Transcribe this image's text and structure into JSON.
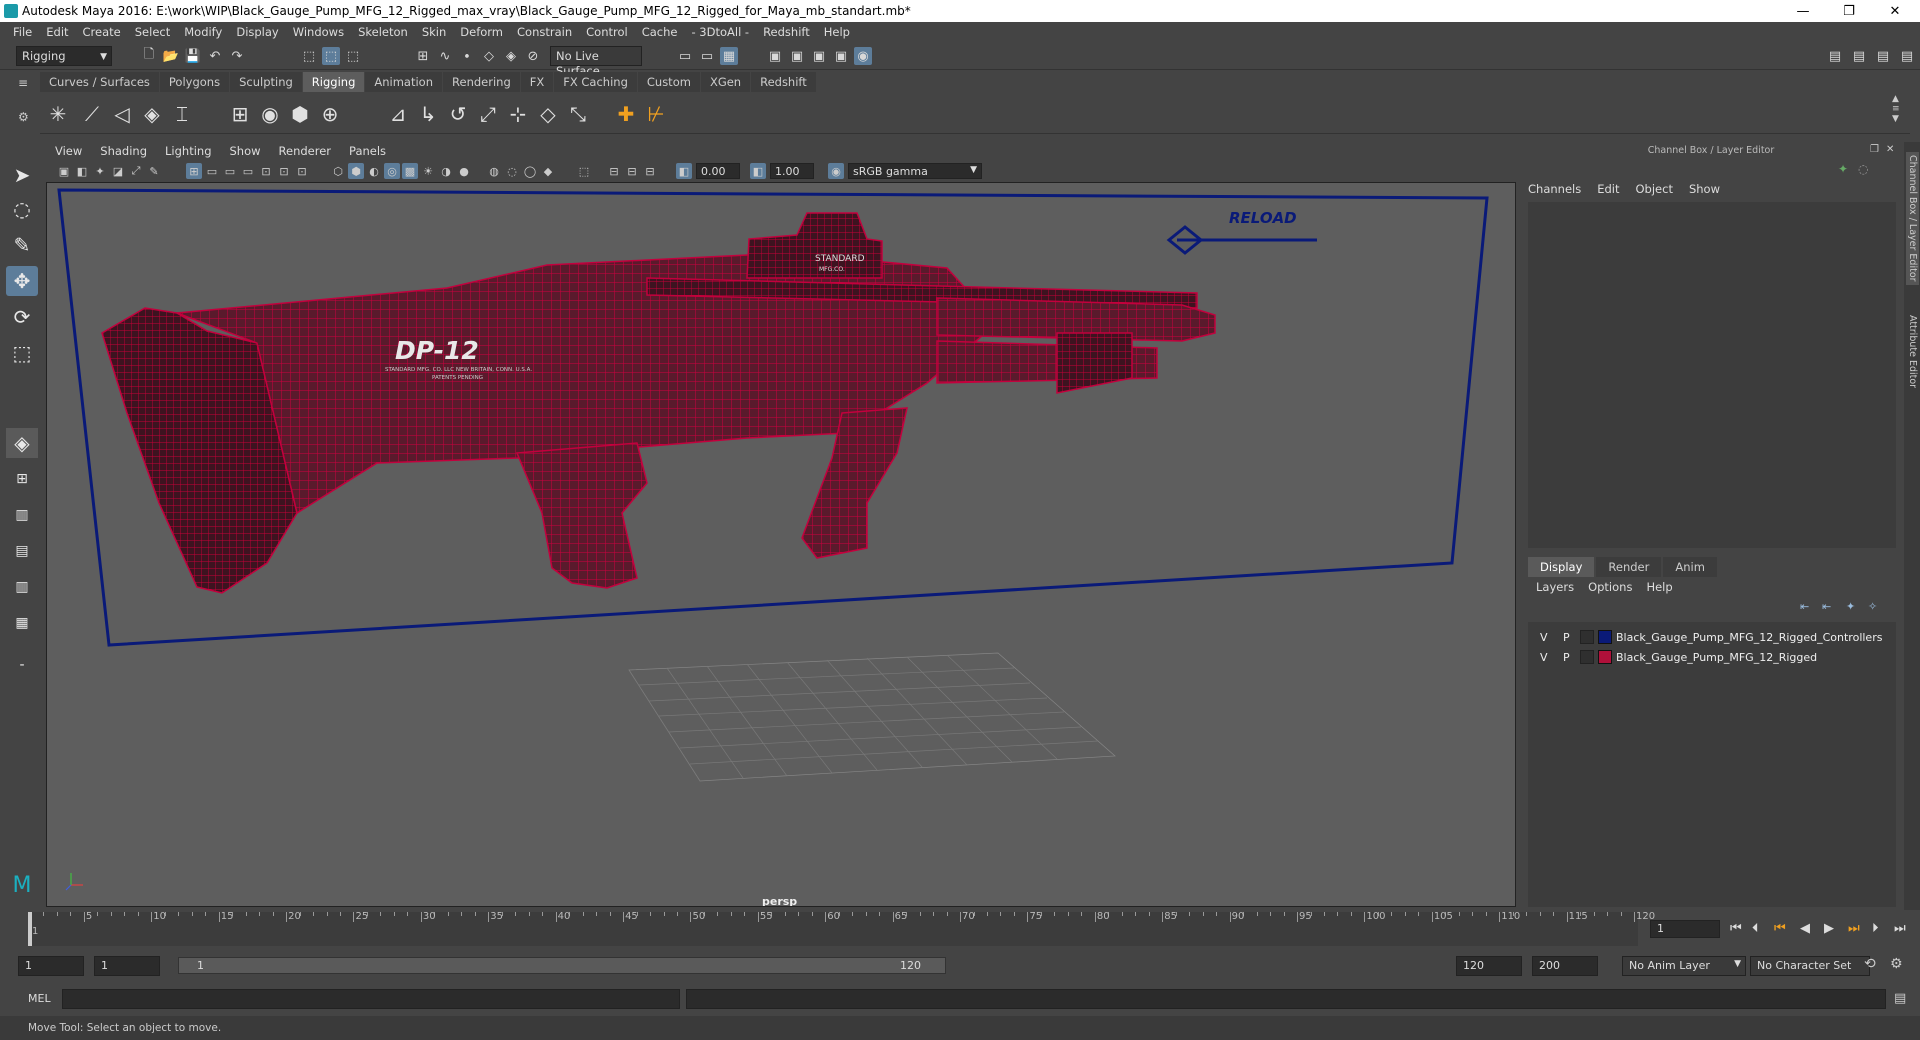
{
  "window": {
    "title": "Autodesk Maya 2016: E:\\work\\WIP\\Black_Gauge_Pump_MFG_12_Rigged_max_vray\\Black_Gauge_Pump_MFG_12_Rigged_for_Maya_mb_standart.mb*",
    "minimize": "—",
    "restore": "❐",
    "close": "✕"
  },
  "menubar": [
    "File",
    "Edit",
    "Create",
    "Select",
    "Modify",
    "Display",
    "Windows",
    "Skeleton",
    "Skin",
    "Deform",
    "Constrain",
    "Control",
    "Cache",
    "- 3DtoAll -",
    "Redshift",
    "Help"
  ],
  "statusline": {
    "mode": "Rigging",
    "live_surface": "No Live Surface"
  },
  "shelf_tabs": [
    "Curves / Surfaces",
    "Polygons",
    "Sculpting",
    "Rigging",
    "Animation",
    "Rendering",
    "FX",
    "FX Caching",
    "Custom",
    "XGen",
    "Redshift"
  ],
  "active_shelf_tab": "Rigging",
  "panel_menu": [
    "View",
    "Shading",
    "Lighting",
    "Show",
    "Renderer",
    "Panels"
  ],
  "panel_toolbar": {
    "exposure": "0.00",
    "gamma": "1.00",
    "colorspace": "sRGB gamma"
  },
  "viewport": {
    "camera": "persp",
    "model_text": {
      "logo": "DP-12",
      "company": "STANDARD MFG. CO. LLC  NEW BRITAIN, CONN. U.S.A.",
      "patents": "PATENTS PENDING",
      "sight_line1": "STANDARD",
      "sight_line2": "MFG.CO."
    },
    "reload_label": "RELOAD",
    "colors": {
      "wire": "#c3003d",
      "controller": "#0a1a78",
      "bg": "#5e5e5e"
    }
  },
  "channel_box": {
    "title": "Channel Box / Layer Editor",
    "menu": [
      "Channels",
      "Edit",
      "Object",
      "Show"
    ]
  },
  "layer_editor": {
    "tabs": [
      "Display",
      "Render",
      "Anim"
    ],
    "active_tab": "Display",
    "menu": [
      "Layers",
      "Options",
      "Help"
    ],
    "layers": [
      {
        "v": "V",
        "p": "P",
        "name": "Black_Gauge_Pump_MFG_12_Rigged_Controllers",
        "color": "#0a1a78"
      },
      {
        "v": "V",
        "p": "P",
        "name": "Black_Gauge_Pump_MFG_12_Rigged",
        "color": "#b0103a"
      }
    ]
  },
  "side_tabs": [
    "Channel Box / Layer Editor",
    "Attribute Editor"
  ],
  "time_slider": {
    "ticks": [
      "1",
      "5",
      "10",
      "15",
      "20",
      "25",
      "30",
      "35",
      "40",
      "45",
      "50",
      "55",
      "60",
      "65",
      "70",
      "75",
      "80",
      "85",
      "90",
      "95",
      "100",
      "105",
      "110",
      "115",
      "120"
    ],
    "current_frame": "1"
  },
  "range": {
    "start": "1",
    "playback_start": "1",
    "slider_start": "1",
    "slider_end": "120",
    "playback_end": "120",
    "end": "200",
    "anim_layer": "No Anim Layer",
    "character_set": "No Character Set"
  },
  "command_line": {
    "label": "MEL"
  },
  "help_line": "Move Tool: Select an object to move."
}
